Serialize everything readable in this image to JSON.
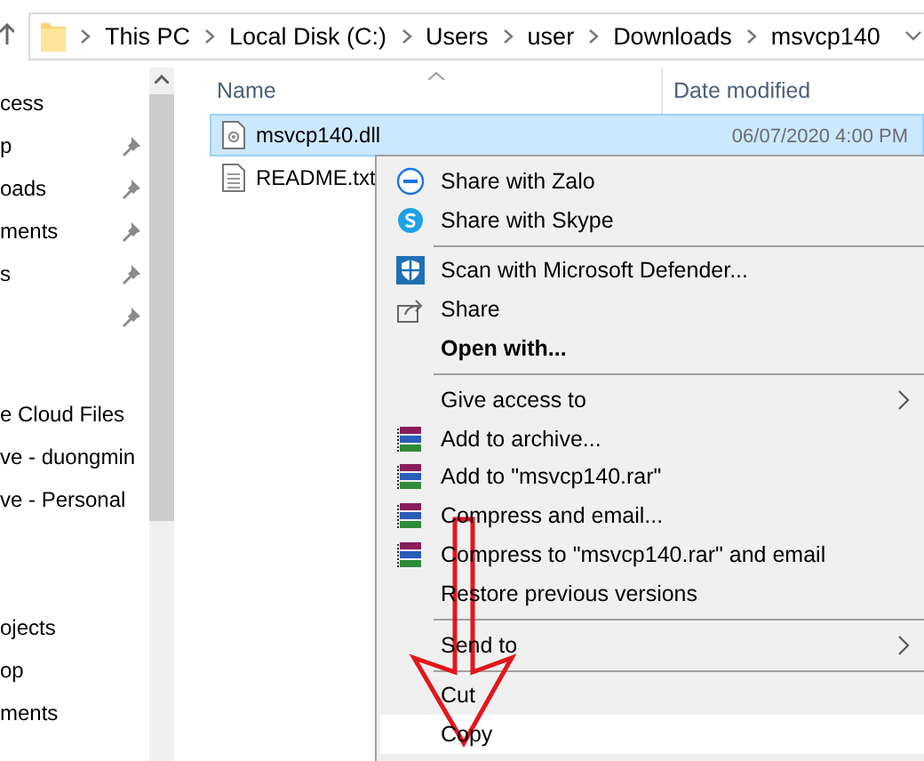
{
  "address_bar": {
    "crumbs": [
      "This PC",
      "Local Disk (C:)",
      "Users",
      "user",
      "Downloads",
      "msvcp140"
    ]
  },
  "sidebar": {
    "sections": [
      {
        "items": [
          {
            "label": "cess",
            "pinned": false
          },
          {
            "label": "p",
            "pinned": true
          },
          {
            "label": "oads",
            "pinned": true
          },
          {
            "label": "ments",
            "pinned": true
          },
          {
            "label": "s",
            "pinned": true
          },
          {
            "pinned": true
          }
        ]
      },
      {
        "items": [
          {
            "label": "e Cloud Files",
            "pinned": false
          },
          {
            "label": "ve - duongmin",
            "pinned": false
          },
          {
            "label": "ve - Personal",
            "pinned": false
          }
        ]
      },
      {
        "items": [
          {
            "label": "ojects",
            "pinned": false
          },
          {
            "label": "op",
            "pinned": false
          },
          {
            "label": "ments",
            "pinned": false
          }
        ]
      }
    ]
  },
  "file_list": {
    "columns": [
      "Name",
      "Date modified"
    ],
    "files": [
      {
        "name": "msvcp140.dll",
        "kind": "dll",
        "date": "06/07/2020 4:00 PM",
        "selected": true
      },
      {
        "name": "README.txt",
        "kind": "txt",
        "selected": false
      }
    ]
  },
  "context_menu": {
    "items": [
      {
        "kind": "zalo",
        "label": "Share with Zalo"
      },
      {
        "kind": "skype",
        "label": "Share with Skype"
      },
      {
        "kind": "separator"
      },
      {
        "kind": "defender",
        "label": "Scan with Microsoft Defender..."
      },
      {
        "kind": "share",
        "label": "Share"
      },
      {
        "kind": "plain",
        "label": "Open with...",
        "bold": true
      },
      {
        "kind": "separator"
      },
      {
        "kind": "plain",
        "label": "Give access to",
        "submenu": true
      },
      {
        "kind": "archive",
        "label": "Add to archive..."
      },
      {
        "kind": "archive",
        "label": "Add to \"msvcp140.rar\""
      },
      {
        "kind": "archive",
        "label": "Compress and email..."
      },
      {
        "kind": "archive",
        "label": "Compress to \"msvcp140.rar\" and email"
      },
      {
        "kind": "plain",
        "label": "Restore previous versions"
      },
      {
        "kind": "separator"
      },
      {
        "kind": "plain",
        "label": "Send to",
        "submenu": true
      },
      {
        "kind": "separator"
      },
      {
        "kind": "plain",
        "label": "Cut",
        "selected": false
      },
      {
        "kind": "plain",
        "label": "Copy",
        "selected": true
      }
    ]
  }
}
